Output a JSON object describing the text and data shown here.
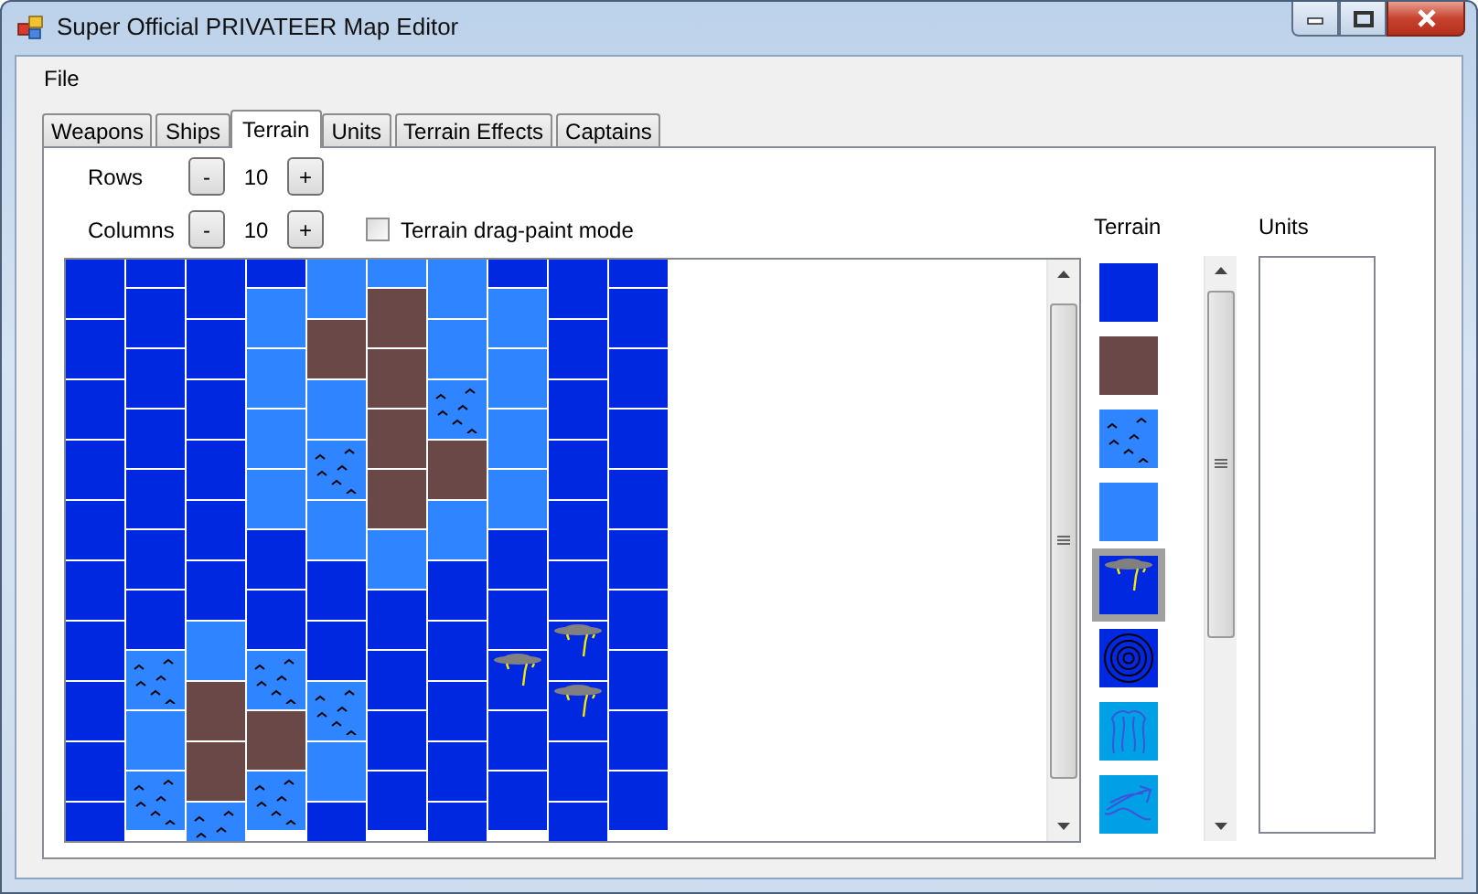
{
  "window": {
    "title": "Super Official PRIVATEER Map Editor"
  },
  "menu": [
    {
      "label": "File"
    }
  ],
  "tabs": [
    {
      "label": "Weapons",
      "selected": false
    },
    {
      "label": "Ships",
      "selected": false
    },
    {
      "label": "Terrain",
      "selected": true
    },
    {
      "label": "Units",
      "selected": false
    },
    {
      "label": "Terrain Effects",
      "selected": false
    },
    {
      "label": "Captains",
      "selected": false
    }
  ],
  "rows": {
    "label": "Rows",
    "minus": "-",
    "value": "10",
    "plus": "+"
  },
  "columns": {
    "label": "Columns",
    "minus": "-",
    "value": "10",
    "plus": "+"
  },
  "drag_paint": {
    "label": "Terrain drag-paint mode",
    "checked": false
  },
  "map": {
    "columns": [
      [
        {
          "kind": "deep"
        },
        {
          "kind": "deep"
        },
        {
          "kind": "deep"
        },
        {
          "kind": "deep"
        },
        {
          "kind": "deep"
        },
        {
          "kind": "deep"
        },
        {
          "kind": "deep"
        },
        {
          "kind": "deep"
        },
        {
          "kind": "deep"
        },
        {
          "kind": "deep"
        }
      ],
      [
        {
          "kind": "deep"
        },
        {
          "kind": "deep"
        },
        {
          "kind": "deep"
        },
        {
          "kind": "deep"
        },
        {
          "kind": "deep"
        },
        {
          "kind": "deep"
        },
        {
          "kind": "deep"
        },
        {
          "kind": "reef"
        },
        {
          "kind": "shallow"
        },
        {
          "kind": "reef"
        }
      ],
      [
        {
          "kind": "deep"
        },
        {
          "kind": "deep"
        },
        {
          "kind": "deep"
        },
        {
          "kind": "deep"
        },
        {
          "kind": "deep"
        },
        {
          "kind": "deep"
        },
        {
          "kind": "shallow"
        },
        {
          "kind": "land"
        },
        {
          "kind": "land"
        },
        {
          "kind": "reef"
        }
      ],
      [
        {
          "kind": "deep"
        },
        {
          "kind": "shallow"
        },
        {
          "kind": "shallow"
        },
        {
          "kind": "shallow"
        },
        {
          "kind": "shallow"
        },
        {
          "kind": "deep"
        },
        {
          "kind": "deep"
        },
        {
          "kind": "reef"
        },
        {
          "kind": "land"
        },
        {
          "kind": "reef"
        }
      ],
      [
        {
          "kind": "shallow"
        },
        {
          "kind": "land"
        },
        {
          "kind": "shallow"
        },
        {
          "kind": "reef"
        },
        {
          "kind": "shallow"
        },
        {
          "kind": "deep"
        },
        {
          "kind": "deep"
        },
        {
          "kind": "reef"
        },
        {
          "kind": "shallow"
        },
        {
          "kind": "deep"
        }
      ],
      [
        {
          "kind": "shallow"
        },
        {
          "kind": "land"
        },
        {
          "kind": "land"
        },
        {
          "kind": "land"
        },
        {
          "kind": "land"
        },
        {
          "kind": "shallow"
        },
        {
          "kind": "deep"
        },
        {
          "kind": "deep"
        },
        {
          "kind": "deep"
        },
        {
          "kind": "deep"
        }
      ],
      [
        {
          "kind": "shallow"
        },
        {
          "kind": "shallow"
        },
        {
          "kind": "reef"
        },
        {
          "kind": "land"
        },
        {
          "kind": "shallow"
        },
        {
          "kind": "deep"
        },
        {
          "kind": "deep"
        },
        {
          "kind": "deep"
        },
        {
          "kind": "deep"
        },
        {
          "kind": "deep"
        }
      ],
      [
        {
          "kind": "deep"
        },
        {
          "kind": "shallow"
        },
        {
          "kind": "shallow"
        },
        {
          "kind": "shallow"
        },
        {
          "kind": "shallow"
        },
        {
          "kind": "deep"
        },
        {
          "kind": "deep"
        },
        {
          "kind": "storm"
        },
        {
          "kind": "deep"
        },
        {
          "kind": "deep"
        }
      ],
      [
        {
          "kind": "deep"
        },
        {
          "kind": "deep"
        },
        {
          "kind": "deep"
        },
        {
          "kind": "deep"
        },
        {
          "kind": "deep"
        },
        {
          "kind": "deep"
        },
        {
          "kind": "storm"
        },
        {
          "kind": "storm"
        },
        {
          "kind": "deep"
        },
        {
          "kind": "deep"
        }
      ],
      [
        {
          "kind": "deep"
        },
        {
          "kind": "deep"
        },
        {
          "kind": "deep"
        },
        {
          "kind": "deep"
        },
        {
          "kind": "deep"
        },
        {
          "kind": "deep"
        },
        {
          "kind": "deep"
        },
        {
          "kind": "deep"
        },
        {
          "kind": "deep"
        },
        {
          "kind": "deep"
        }
      ]
    ]
  },
  "terrain_panel": {
    "label": "Terrain",
    "palette": [
      {
        "kind": "deep",
        "selected": false
      },
      {
        "kind": "land",
        "selected": false
      },
      {
        "kind": "reef",
        "selected": false
      },
      {
        "kind": "shallow",
        "selected": false
      },
      {
        "kind": "storm",
        "selected": true
      },
      {
        "kind": "whirlpool",
        "selected": false
      },
      {
        "kind": "current_up",
        "selected": false
      },
      {
        "kind": "current_right",
        "selected": false
      }
    ]
  },
  "units_panel": {
    "label": "Units"
  }
}
